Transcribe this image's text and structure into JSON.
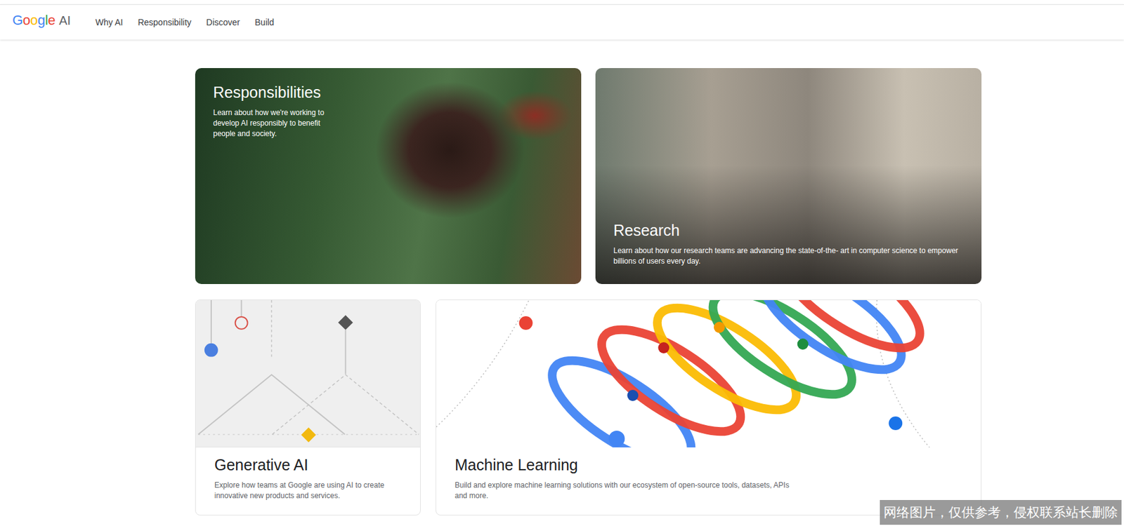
{
  "header": {
    "logo": [
      {
        "text": "G",
        "color": "#4285f4"
      },
      {
        "text": "o",
        "color": "#ea4335"
      },
      {
        "text": "o",
        "color": "#fbbc04"
      },
      {
        "text": "g",
        "color": "#4285f4"
      },
      {
        "text": "l",
        "color": "#34a853"
      },
      {
        "text": "e",
        "color": "#ea4335"
      }
    ],
    "product": "AI",
    "nav": [
      {
        "label": "Why AI",
        "selected": false
      },
      {
        "label": "Responsibility",
        "selected": false
      },
      {
        "label": "Discover",
        "selected": false
      },
      {
        "label": "Build",
        "selected": false
      }
    ]
  },
  "cards": [
    {
      "kind": "photo-bird",
      "title": "Responsibilities",
      "description": "Learn about how we're working to develop AI responsibly to benefit people and society."
    },
    {
      "kind": "photo-robot",
      "title": "Research",
      "description": "Learn about how our research teams are advancing the state-of-the- art in computer science to empower billions of users every day."
    },
    {
      "kind": "art-shapes",
      "title": "Generative AI",
      "description": "Explore how teams at Google are using AI to create innovative new products and services."
    },
    {
      "kind": "art-loops",
      "title": "Machine Learning",
      "description": "Build and explore machine learning solutions with our ecosystem of open-source tools, datasets, APIs and more."
    }
  ],
  "watermark": "网络图片，仅供参考，侵权联系站长删除"
}
